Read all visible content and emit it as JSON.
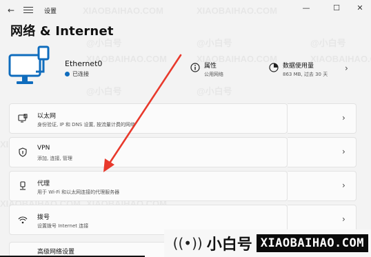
{
  "window": {
    "title": "设置",
    "back_icon": "back-arrow-icon",
    "menu_icon": "hamburger-icon",
    "controls": [
      "—",
      "☐",
      "✕"
    ]
  },
  "page": {
    "title": "网络 & Internet"
  },
  "device": {
    "name": "Ethernet0",
    "status": "已连接",
    "icon": "ethernet-monitor-icon",
    "accent": "#0f6cbd"
  },
  "properties": {
    "title": "属性",
    "subtitle": "公用网络",
    "icon": "info-icon"
  },
  "data_usage": {
    "title": "数据使用量",
    "subtitle": "863 MB, 过去 30 天",
    "icon": "pie-usage-icon"
  },
  "settings": [
    {
      "title": "以太网",
      "subtitle": "身份验证, IP 和 DNS 设置, 按流量计费的网络",
      "icon": "ethernet-icon"
    },
    {
      "title": "VPN",
      "subtitle": "添加, 连接, 管理",
      "icon": "shield-icon"
    },
    {
      "title": "代理",
      "subtitle": "用于 Wi-Fi 和以太网连接的代理服务器",
      "icon": "proxy-icon"
    },
    {
      "title": "拨号",
      "subtitle": "设置拨号 Internet 连接",
      "icon": "dialup-icon"
    },
    {
      "title": "高级网络设置",
      "subtitle": "",
      "icon": ""
    }
  ],
  "watermark": {
    "cn": "小白号",
    "en": "XIAOBAIHAO.COM",
    "faint": "XIAOBAIHAO.COM",
    "faint_at": "@小白号",
    "icon": "broadcast-icon"
  },
  "annotation": {
    "arrow_color": "#e8392c"
  }
}
